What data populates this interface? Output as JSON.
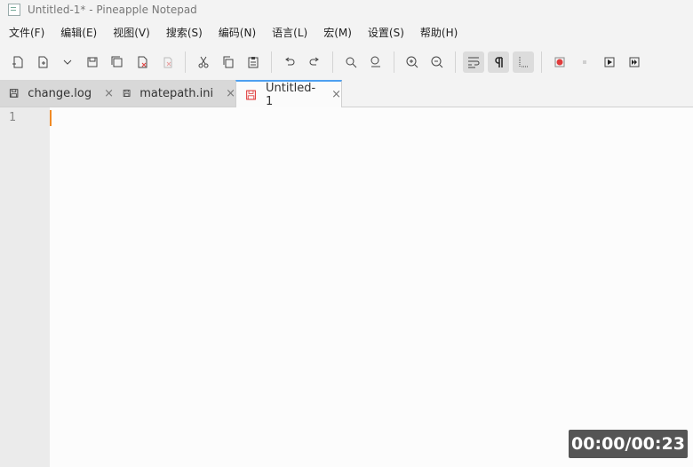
{
  "window": {
    "title": "Untitled-1* - Pineapple Notepad"
  },
  "menu": [
    "文件(F)",
    "编辑(E)",
    "视图(V)",
    "搜索(S)",
    "编码(N)",
    "语言(L)",
    "宏(M)",
    "设置(S)",
    "帮助(H)"
  ],
  "tabs": [
    {
      "label": "change.log",
      "close": "×"
    },
    {
      "label": "matepath.ini",
      "close": "×"
    },
    {
      "label": "Untitled-1",
      "close": "×"
    }
  ],
  "editor": {
    "line_numbers": [
      "1"
    ]
  },
  "timer": {
    "text": "00:00/00:23"
  },
  "colors": {
    "accent": "#4ea0f0",
    "caret": "#f08a24",
    "record": "#e03b3b"
  }
}
